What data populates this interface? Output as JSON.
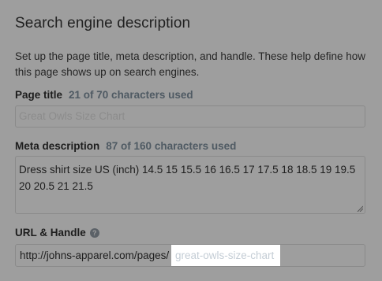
{
  "section": {
    "title": "Search engine description",
    "description": "Set up the page title, meta description, and handle. These help define how this page shows up on search engines."
  },
  "page_title": {
    "label": "Page title",
    "counter": "21 of 70 characters used",
    "placeholder": "Great Owls Size Chart"
  },
  "meta_description": {
    "label": "Meta description",
    "counter": "87 of 160 characters used",
    "value": "Dress shirt size US (inch) 14.5 15 15.5 16 16.5 17 17.5 18 18.5 19 19.5 20 20.5 21 21.5"
  },
  "url_handle": {
    "label": "URL & Handle",
    "help_icon": "question-circle-icon",
    "prefix": "http://johns-apparel.com/pages/",
    "handle_placeholder": "great-owls-size-chart"
  },
  "colors": {
    "overlay_background": "#9e9e9e",
    "handle_background": "#ffffff",
    "placeholder_text": "#c4cdd5"
  }
}
